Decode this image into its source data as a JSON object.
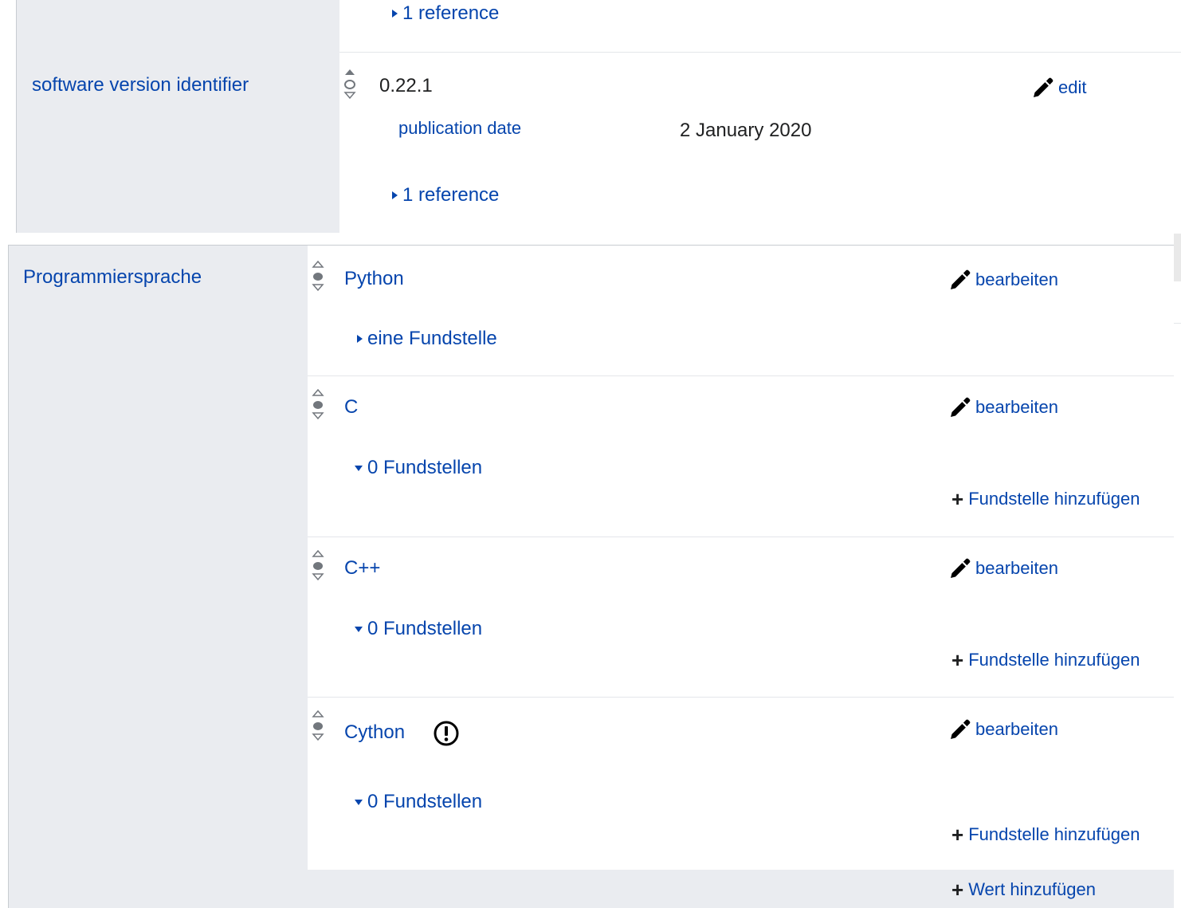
{
  "top_statement": {
    "reference_toggle": "1 reference"
  },
  "software_version": {
    "property_label": "software version identifier",
    "value": "0.22.1",
    "edit_label": "edit",
    "qualifier_property": "publication date",
    "qualifier_value": "2 January 2020",
    "reference_toggle": "1 reference"
  },
  "programming_language": {
    "property_label": "Programmiersprache",
    "statements": [
      {
        "value": "Python",
        "edit_label": "bearbeiten",
        "reference_toggle": "eine Fundstelle",
        "expanded": false
      },
      {
        "value": "C",
        "edit_label": "bearbeiten",
        "reference_toggle": "0 Fundstellen",
        "expanded": true,
        "add_reference": "Fundstelle hinzufügen"
      },
      {
        "value": "C++",
        "edit_label": "bearbeiten",
        "reference_toggle": "0 Fundstellen",
        "expanded": true,
        "add_reference": "Fundstelle hinzufügen"
      },
      {
        "value": "Cython",
        "edit_label": "bearbeiten",
        "reference_toggle": "0 Fundstellen",
        "expanded": true,
        "add_reference": "Fundstelle hinzufügen",
        "has_warning": true
      }
    ],
    "add_value": "Wert hinzufügen"
  },
  "icons": {
    "rank": "rank-selector-icon",
    "edit": "pencil-icon",
    "add": "plus-icon",
    "warning": "exclamation-circle-icon"
  },
  "colors": {
    "link": "#0645ad",
    "label_background": "#eaecf0",
    "text": "#202122"
  }
}
